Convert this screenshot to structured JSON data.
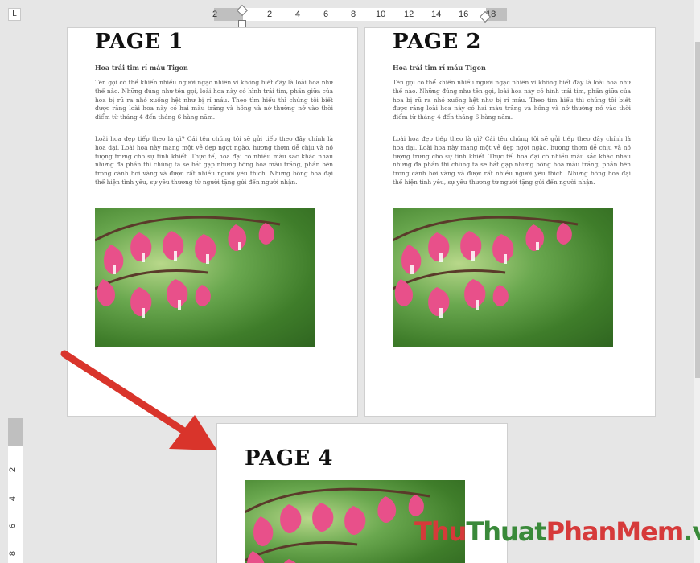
{
  "ruler": {
    "corner_symbol": "L",
    "h_ticks": [
      "2",
      "2",
      "4",
      "6",
      "8",
      "10",
      "12",
      "14",
      "16",
      "18"
    ],
    "v_ticks": [
      "2",
      "4",
      "6",
      "8"
    ]
  },
  "pages": [
    {
      "title": "PAGE 1",
      "subtitle": "Hoa trái tim rỉ máu Tigon",
      "para1": "Tên gọi có thể khiến nhiều người ngạc nhiên vì không biết đây là loài hoa như thế nào. Những đúng như tên gọi, loài hoa này có hình trái tim, phần giữa của hoa bị rũ ra nhỏ xuống hệt như bị rỉ máu. Theo tìm hiểu thì chúng tôi biết được rằng loài hoa này có hai màu trắng và hồng và nở thường nở vào thời điểm từ tháng 4 đến tháng 6 hàng năm.",
      "para2": "Loài hoa đẹp tiếp theo là gì? Cái tên chúng tôi sẽ gửi tiếp theo đây chính là hoa đại. Loài hoa này mang một vẻ đẹp ngọt ngào, hương thơm dễ chịu và nó tượng trưng cho sự tinh khiết. Thực tế, hoa đại có nhiều màu sắc khác nhau nhưng đa phần thì chúng ta sẽ bắt gặp những bông hoa màu trắng, phần bên trong cánh hơi vàng và được rất nhiều người yêu thích. Những bông hoa đại thể hiện tình yêu, sự yêu thương từ người tặng gửi đến người nhận."
    },
    {
      "title": "PAGE 2",
      "subtitle": "Hoa trái tim rỉ máu Tigon",
      "para1": "Tên gọi có thể khiến nhiều người ngạc nhiên vì không biết đây là loài hoa như thế nào. Những đúng như tên gọi, loài hoa này có hình trái tim, phần giữa của hoa bị rũ ra nhỏ xuống hệt như bị rỉ máu. Theo tìm hiểu thì chúng tôi biết được rằng loài hoa này có hai màu trắng và hồng và nở thường nở vào thời điểm từ tháng 4 đến tháng 6 hàng năm.",
      "para2": "Loài hoa đẹp tiếp theo là gì? Cái tên chúng tôi sẽ gửi tiếp theo đây chính là hoa đại. Loài hoa này mang một vẻ đẹp ngọt ngào, hương thơm dễ chịu và nó tượng trưng cho sự tinh khiết. Thực tế, hoa đại có nhiều màu sắc khác nhau nhưng đa phần thì chúng ta sẽ bắt gặp những bông hoa màu trắng, phần bên trong cánh hơi vàng và được rất nhiều người yêu thích. Những bông hoa đại thể hiện tình yêu, sự yêu thương từ người tặng gửi đến người nhận."
    },
    {
      "title": "PAGE 4"
    }
  ],
  "watermark": {
    "part1": "Thu",
    "part2": "Thuat",
    "part3": "PhanMem",
    "part4": ".vn"
  },
  "colors": {
    "arrow": "#d9342b",
    "page_bg": "#ffffff",
    "workspace_bg": "#e6e6e6"
  }
}
